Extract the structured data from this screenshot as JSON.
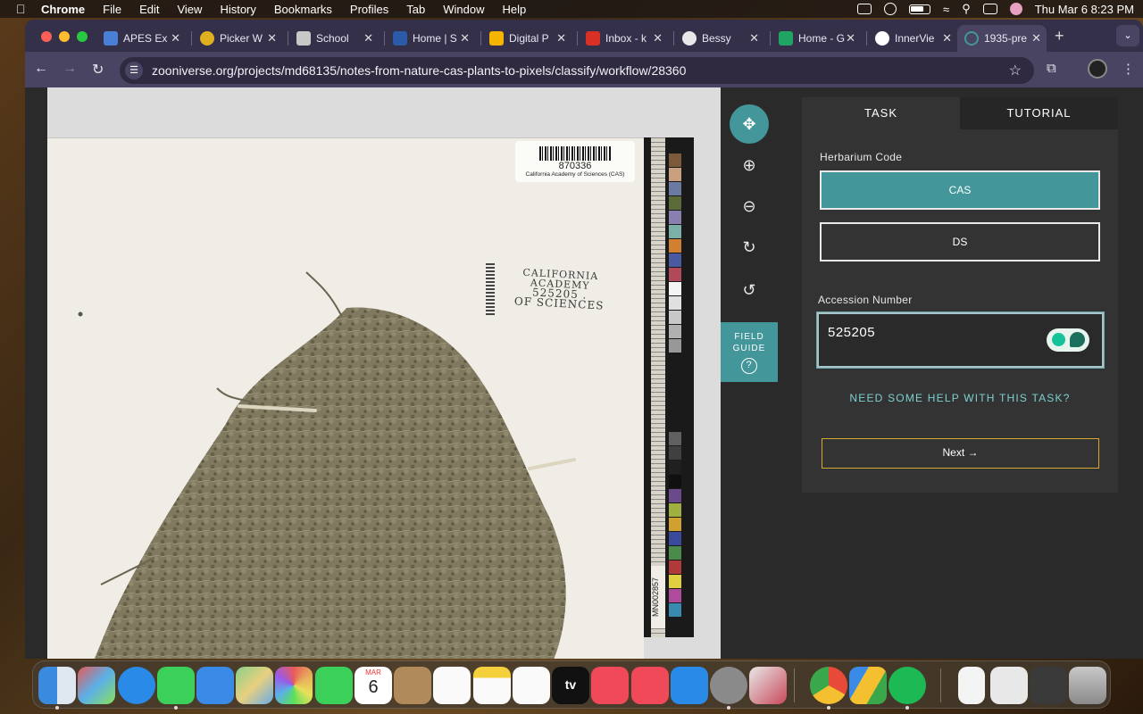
{
  "menubar": {
    "app": "Chrome",
    "items": [
      "File",
      "Edit",
      "View",
      "History",
      "Bookmarks",
      "Profiles",
      "Tab",
      "Window",
      "Help"
    ],
    "datetime": "Thu Mar 6  8:23 PM"
  },
  "tabs": [
    {
      "title": "APES Ex",
      "color": "#4a7fd6"
    },
    {
      "title": "Picker W",
      "color": "#e0b020"
    },
    {
      "title": "School",
      "color": "#c8c8c8"
    },
    {
      "title": "Home | S",
      "color": "#2a5aa8"
    },
    {
      "title": "Digital P",
      "color": "#f4b400"
    },
    {
      "title": "Inbox - k",
      "color": "#d93025"
    },
    {
      "title": "Bessy",
      "color": "#e8e8e8"
    },
    {
      "title": "Home - G",
      "color": "#1fa463"
    },
    {
      "title": "InnerVie",
      "color": "#ffffff"
    },
    {
      "title": "1935-pre",
      "color": "#43969a"
    }
  ],
  "toolbar": {
    "url": "zooniverse.org/projects/md68135/notes-from-nature-cas-plants-to-pixels/classify/workflow/28360"
  },
  "specimen": {
    "barcode_number": "870336",
    "barcode_institution": "California Academy of Sciences (CAS)",
    "stamp_line1": "CALIFORNIA",
    "stamp_line2": "ACADEMY",
    "stamp_number": "525205 .",
    "stamp_line3": "OF SCIENCES",
    "ruler_id": "MN002857"
  },
  "tools": {
    "move_label": "move",
    "field_guide_label": "FIELD GUIDE"
  },
  "panel": {
    "tab_task": "TASK",
    "tab_tutorial": "TUTORIAL",
    "herbarium_label": "Herbarium Code",
    "choices": [
      "CAS",
      "DS"
    ],
    "selected_choice": "CAS",
    "accession_label": "Accession Number",
    "accession_value": "525205",
    "help_link": "NEED SOME HELP WITH THIS TASK?",
    "next_button": "Next →",
    "accent_color": "#43969a"
  },
  "dock": {
    "calendar_month": "MAR",
    "calendar_day": "6",
    "tv_label": "tv"
  }
}
